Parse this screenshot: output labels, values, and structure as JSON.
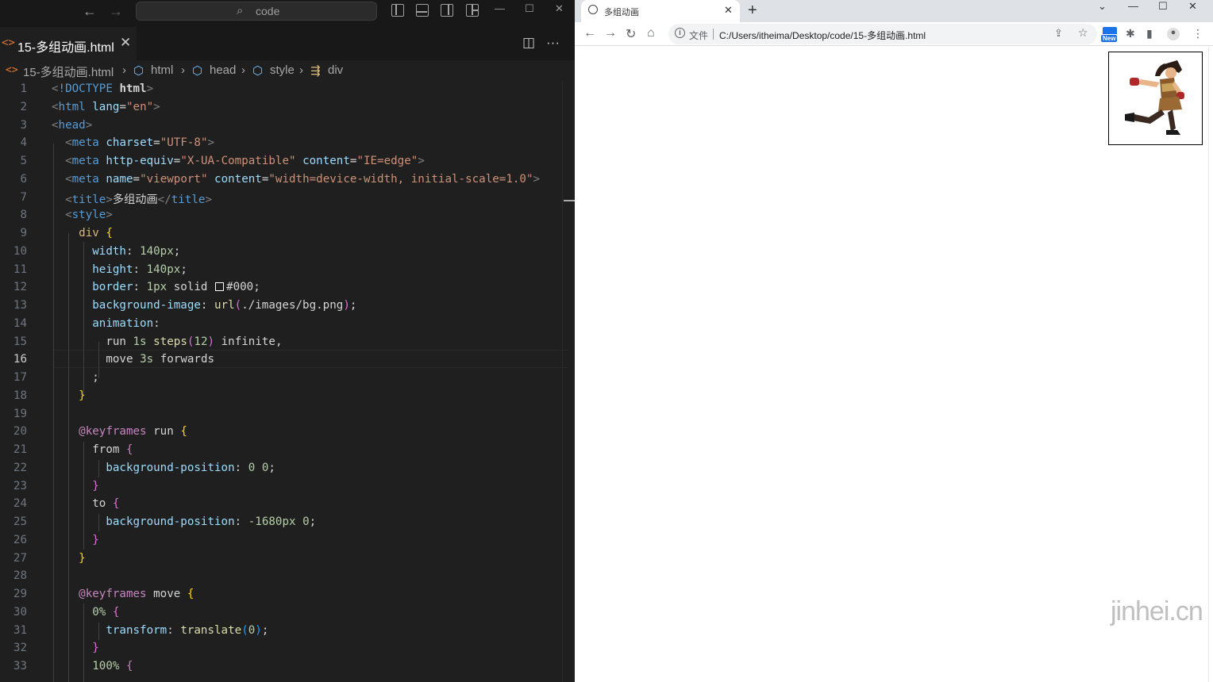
{
  "editor": {
    "search_text": "code",
    "tab": {
      "file_name": "15-多组动画.html"
    },
    "breadcrumb": [
      "15-多组动画.html",
      "html",
      "head",
      "style",
      "div"
    ],
    "current_line": 16,
    "lines": [
      "1",
      "2",
      "3",
      "4",
      "5",
      "6",
      "7",
      "8",
      "9",
      "10",
      "11",
      "12",
      "13",
      "14",
      "15",
      "16",
      "17",
      "18",
      "19",
      "20",
      "21",
      "22",
      "23",
      "24",
      "25",
      "26",
      "27",
      "28",
      "29",
      "30",
      "31",
      "32",
      "33"
    ],
    "code": {
      "l1_tag": "!DOCTYPE",
      "l1_kw": "html",
      "l2_tag": "html",
      "l2_attr": "lang",
      "l2_val": "\"en\"",
      "l3_tag": "head",
      "l4_tag": "meta",
      "l4_attr": "charset",
      "l4_val": "\"UTF-8\"",
      "l5_tag": "meta",
      "l5_attr1": "http-equiv",
      "l5_val1": "\"X-UA-Compatible\"",
      "l5_attr2": "content",
      "l5_val2": "\"IE=edge\"",
      "l6_tag": "meta",
      "l6_attr1": "name",
      "l6_val1": "\"viewport\"",
      "l6_attr2": "content",
      "l6_val2": "\"width=device-width, initial-scale=1.0\"",
      "l7_tag": "title",
      "l7_text": "多组动画",
      "l8_tag": "style",
      "l9_sel": "div",
      "l10_prop": "width",
      "l10_val": "140px",
      "l11_prop": "height",
      "l11_val": "140px",
      "l12_prop": "border",
      "l12_val1": "1px",
      "l12_val2": "solid",
      "l12_color": "#000",
      "l13_prop": "background-image",
      "l13_fn": "url",
      "l13_arg": "./images/bg.png",
      "l14_prop": "animation",
      "l15_a": "run",
      "l15_b": "1s",
      "l15_fn": "steps",
      "l15_n": "12",
      "l15_c": "infinite",
      "l16_a": "move",
      "l16_b": "3s",
      "l16_c": "forwards",
      "l20_at": "@keyframes",
      "l20_name": "run",
      "l21_sel": "from",
      "l22_prop": "background-position",
      "l22_v1": "0",
      "l22_v2": "0",
      "l24_sel": "to",
      "l25_prop": "background-position",
      "l25_v1": "-1680px",
      "l25_v2": "0",
      "l29_at": "@keyframes",
      "l29_name": "move",
      "l30_sel": "0%",
      "l31_prop": "transform",
      "l31_fn": "translate",
      "l31_arg": "0",
      "l33_sel": "100%"
    }
  },
  "browser": {
    "tab_title": "多组动画",
    "scheme_label": "文件",
    "url": "C:/Users/itheima/Desktop/code/15-多组动画.html",
    "new_badge": "New"
  },
  "watermark": "jinhei.cn",
  "colors": {
    "editor_bg": "#1f1f1f",
    "browser_bg": "#ffffff",
    "tab_icon": "#e37933"
  }
}
